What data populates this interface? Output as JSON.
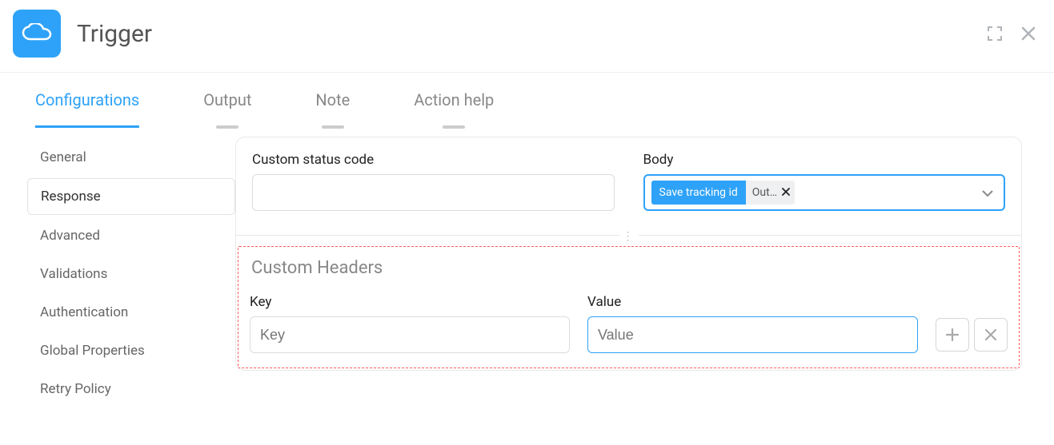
{
  "header": {
    "title": "Trigger"
  },
  "tabs": {
    "items": [
      {
        "label": "Configurations",
        "active": true
      },
      {
        "label": "Output",
        "active": false
      },
      {
        "label": "Note",
        "active": false
      },
      {
        "label": "Action help",
        "active": false
      }
    ]
  },
  "sidebar": {
    "items": [
      {
        "label": "General"
      },
      {
        "label": "Response",
        "selected": true
      },
      {
        "label": "Advanced"
      },
      {
        "label": "Validations"
      },
      {
        "label": "Authentication"
      },
      {
        "label": "Global Properties"
      },
      {
        "label": "Retry Policy"
      }
    ]
  },
  "form": {
    "status_code": {
      "label": "Custom status code",
      "value": ""
    },
    "body": {
      "label": "Body",
      "chip_left": "Save tracking id",
      "chip_right": "Out…"
    },
    "custom_headers": {
      "title": "Custom Headers",
      "key_label": "Key",
      "key_placeholder": "Key",
      "key_value": "",
      "value_label": "Value",
      "value_placeholder": "Value",
      "value_value": ""
    }
  }
}
